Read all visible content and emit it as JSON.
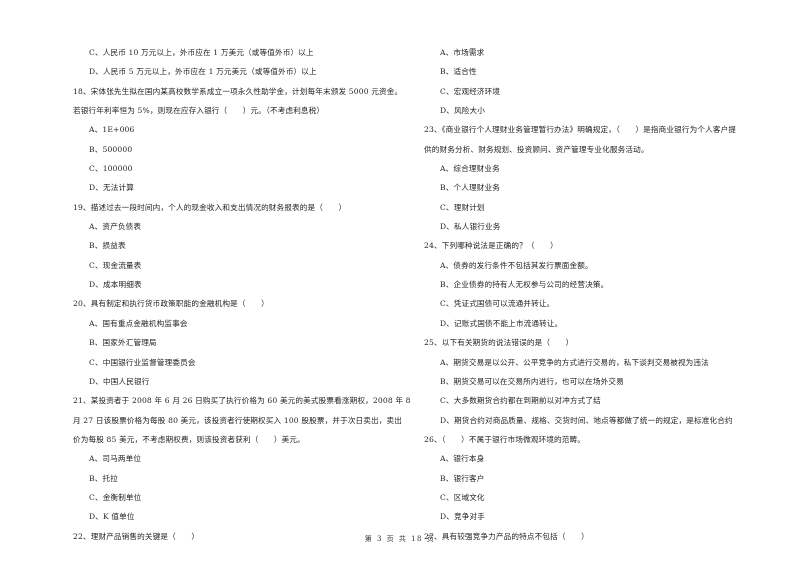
{
  "left_column": [
    {
      "type": "opt",
      "text": "C、人民币 10 万元以上，外币应在 1 万美元（或等值外币）以上"
    },
    {
      "type": "opt",
      "text": "D、人民币 5 万元以上，外币应在 1 万元美元（或等值外币）以上"
    },
    {
      "type": "q",
      "text": "18、宋体张先生拟在国内某高校数学系成立一项永久性助学金，计划每年末颁发 5000 元资金。"
    },
    {
      "type": "q",
      "text": "若银行年利率恒为 5%，则现在应存入银行（　　）元。（不考虑利息税）"
    },
    {
      "type": "opt",
      "text": "A、1E+006"
    },
    {
      "type": "opt",
      "text": "B、500000"
    },
    {
      "type": "opt",
      "text": "C、100000"
    },
    {
      "type": "opt",
      "text": "D、无法计算"
    },
    {
      "type": "q",
      "text": "19、描述过去一段时间内，个人的现金收入和支出情况的财务报表的是（　　）"
    },
    {
      "type": "opt",
      "text": "A、资产负债表"
    },
    {
      "type": "opt",
      "text": "B、损益表"
    },
    {
      "type": "opt",
      "text": "C、现金流量表"
    },
    {
      "type": "opt",
      "text": "D、成本明细表"
    },
    {
      "type": "q",
      "text": "20、具有制定和执行货币政策职能的金融机构是（　　）"
    },
    {
      "type": "opt",
      "text": "A、国有重点金融机构监事会"
    },
    {
      "type": "opt",
      "text": "B、国家外汇管理局"
    },
    {
      "type": "opt",
      "text": "C、中国银行业监督管理委员会"
    },
    {
      "type": "opt",
      "text": "D、中国人民银行"
    },
    {
      "type": "q",
      "text": "21、某投资者于 2008 年 6 月 26 日购买了执行价格为 60 美元的美式股票看涨期权，2008 年 8"
    },
    {
      "type": "q",
      "text": "月 27 日该股票价格为每股 80 美元，该投资者行使期权买入 100 股股票，并于次日卖出，卖出"
    },
    {
      "type": "q",
      "text": "价为每股 85 美元，不考虑期权费，则该投资者获利（　　）美元。"
    },
    {
      "type": "opt",
      "text": "A、司马两单位"
    },
    {
      "type": "opt",
      "text": "B、托拉"
    },
    {
      "type": "opt",
      "text": "C、金衡制单位"
    },
    {
      "type": "opt",
      "text": "D、K 值单位"
    },
    {
      "type": "q",
      "text": "22、理财产品销售的关键是（　　）"
    }
  ],
  "right_column": [
    {
      "type": "opt",
      "text": "A、市场需求"
    },
    {
      "type": "opt",
      "text": "B、适合性"
    },
    {
      "type": "opt",
      "text": "C、宏观经济环境"
    },
    {
      "type": "opt",
      "text": "D、风险大小"
    },
    {
      "type": "q",
      "text": "23、《商业银行个人理财业务管理暂行办法》明确规定，（　　）是指商业银行为个人客户提"
    },
    {
      "type": "q",
      "text": "供的财务分析、财务规划、投资顾问、资产管理专业化服务活动。"
    },
    {
      "type": "opt",
      "text": "A、综合理财业务"
    },
    {
      "type": "opt",
      "text": "B、个人理财业务"
    },
    {
      "type": "opt",
      "text": "C、理财计划"
    },
    {
      "type": "opt",
      "text": "D、私人银行业务"
    },
    {
      "type": "q",
      "text": "24、下列哪种说法是正确的？（　　）"
    },
    {
      "type": "opt",
      "text": "A、债券的发行条件不包括其发行票面金额。"
    },
    {
      "type": "opt",
      "text": "B、企业债券的持有人无权参与公司的经营决策。"
    },
    {
      "type": "opt",
      "text": "C、凭证式国债可以流通并转让。"
    },
    {
      "type": "opt",
      "text": "D、记账式国债不能上市流通转让。"
    },
    {
      "type": "q",
      "text": "25、以下有关期货的说法错误的是（　　）"
    },
    {
      "type": "opt",
      "text": "A、期货交易是以公开、公平竞争的方式进行交易的，私下谈判交易被视为违法"
    },
    {
      "type": "opt",
      "text": "B、期货交易可以在交易所内进行，也可以在场外交易"
    },
    {
      "type": "opt",
      "text": "C、大多数期货合约都在到期前以对冲方式了结"
    },
    {
      "type": "opt",
      "text": "D、期货合约对商品质量、规格、交货时间、地点等都做了统一的规定，是标准化合约"
    },
    {
      "type": "q",
      "text": "26、（　　）不属于银行市场微观环境的范畴。"
    },
    {
      "type": "opt",
      "text": "A、银行本身"
    },
    {
      "type": "opt",
      "text": "B、银行客户"
    },
    {
      "type": "opt",
      "text": "C、区域文化"
    },
    {
      "type": "opt",
      "text": "D、竞争对手"
    },
    {
      "type": "q",
      "text": "27、具有较强竞争力产品的特点不包括（　　）"
    }
  ],
  "footer": {
    "page_label": "第 3 页 共 18 页"
  }
}
